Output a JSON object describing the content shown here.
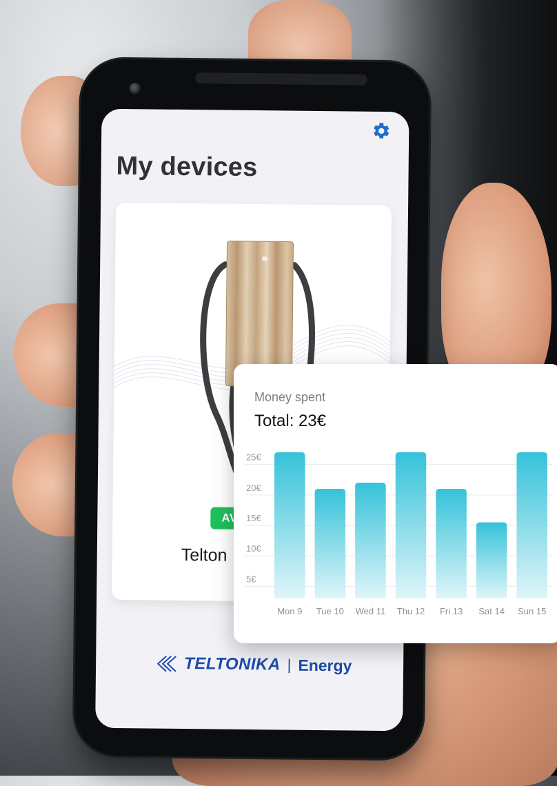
{
  "settings_icon": "gear-icon",
  "page_title": "My devices",
  "device": {
    "status": "AV",
    "name": "Telton"
  },
  "brand": {
    "name": "TELTONIKA",
    "separator": "|",
    "product": "Energy"
  },
  "money_card": {
    "title": "Money spent",
    "total": "Total: 23€"
  },
  "colors": {
    "accent": "#1f6fc9",
    "status_green": "#1fc15b",
    "bar_top": "#35c2d9",
    "bar_bottom": "#dff5f9",
    "brand_blue": "#1c4aa8"
  },
  "chart_data": {
    "type": "bar",
    "categories": [
      "Mon 9",
      "Tue 10",
      "Wed 11",
      "Thu 12",
      "Fri 13",
      "Sat 14",
      "Sun 15"
    ],
    "values": [
      27,
      21,
      22,
      27,
      21,
      15.5,
      27
    ],
    "y_ticks": [
      "25€",
      "20€",
      "15€",
      "10€",
      "5€"
    ],
    "y_tick_values": [
      25,
      20,
      15,
      10,
      5
    ],
    "ylim": [
      3,
      27
    ],
    "grid": true
  }
}
